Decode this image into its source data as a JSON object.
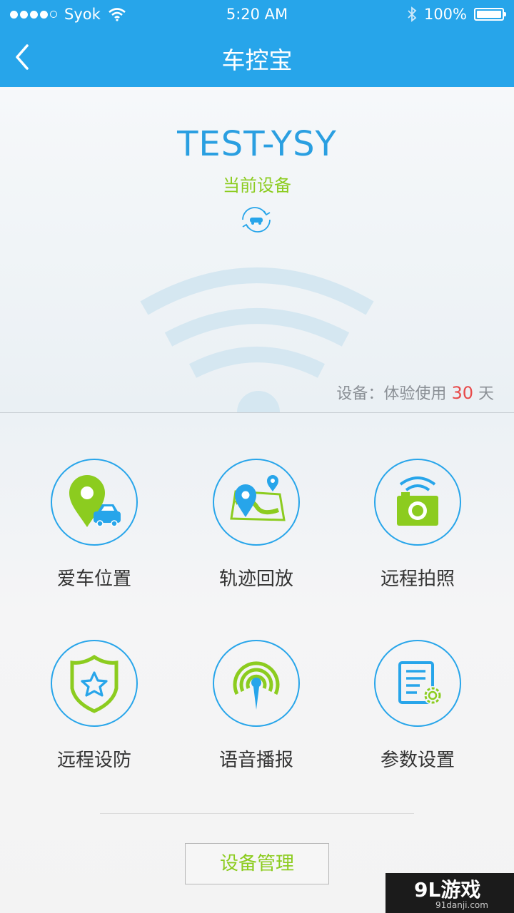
{
  "status_bar": {
    "carrier": "Syok",
    "time": "5:20 AM",
    "battery": "100%",
    "signal_bars": 4
  },
  "header": {
    "title": "车控宝"
  },
  "device": {
    "name": "TEST-YSY",
    "status": "当前设备",
    "trial_prefix": "设备：体验使用",
    "trial_days": "30",
    "trial_suffix": "天"
  },
  "functions": [
    {
      "label": "爱车位置",
      "icon": "car-location-icon"
    },
    {
      "label": "轨迹回放",
      "icon": "track-playback-icon"
    },
    {
      "label": "远程拍照",
      "icon": "remote-camera-icon"
    },
    {
      "label": "远程设防",
      "icon": "shield-star-icon"
    },
    {
      "label": "语音播报",
      "icon": "broadcast-icon"
    },
    {
      "label": "参数设置",
      "icon": "document-gear-icon"
    }
  ],
  "footer": {
    "manage_button": "设备管理"
  },
  "watermark": {
    "brand": "9L游戏",
    "domain": "91danji.com"
  },
  "colors": {
    "primary_blue": "#27a5ea",
    "accent_green": "#8ccc1f",
    "highlight_red": "#e84a4a"
  }
}
